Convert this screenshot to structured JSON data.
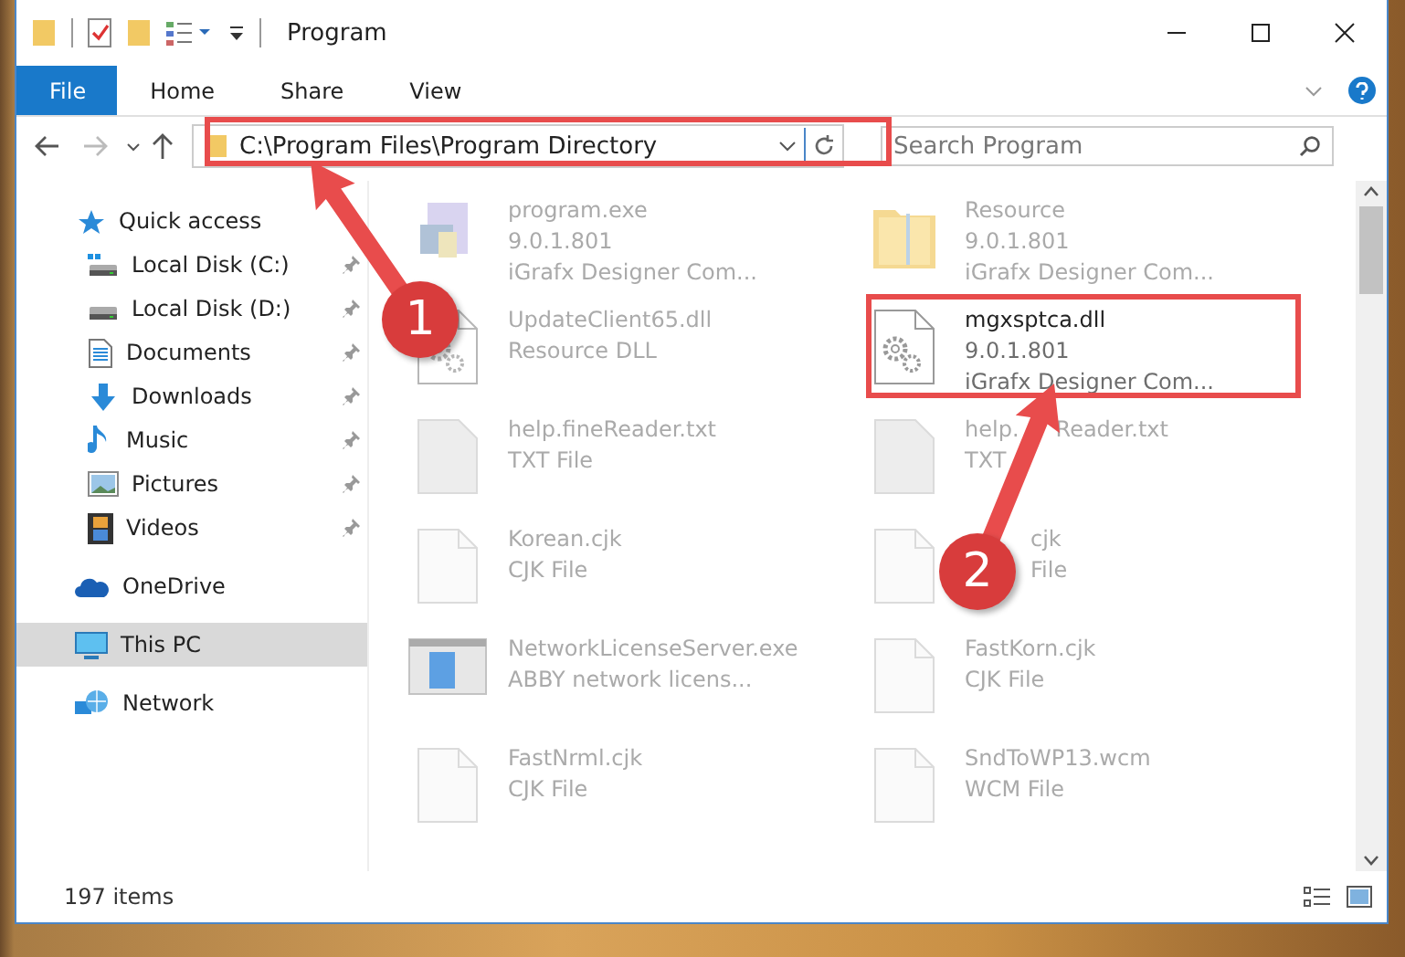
{
  "window": {
    "title": "Program"
  },
  "ribbon_tabs": [
    {
      "label": "File",
      "selected": true
    },
    {
      "label": "Home",
      "selected": false
    },
    {
      "label": "Share",
      "selected": false
    },
    {
      "label": "View",
      "selected": false
    }
  ],
  "address_bar": {
    "path": "C:\\Program Files\\Program Directory"
  },
  "search": {
    "placeholder": "Search Program"
  },
  "sidebar": {
    "items": [
      {
        "label": "Quick access",
        "kind": "star",
        "selected": false,
        "children": [
          {
            "label": "Local Disk (C:)",
            "kind": "drive-c",
            "pinned": true,
            "selected": false
          },
          {
            "label": "Local Disk (D:)",
            "kind": "drive",
            "pinned": true,
            "selected": false
          },
          {
            "label": "Documents",
            "kind": "document",
            "pinned": true,
            "selected": false
          },
          {
            "label": "Downloads",
            "kind": "download",
            "pinned": true,
            "selected": false
          },
          {
            "label": "Music",
            "kind": "music",
            "pinned": true,
            "selected": false
          },
          {
            "label": "Pictures",
            "kind": "pictures",
            "pinned": true,
            "selected": false
          },
          {
            "label": "Videos",
            "kind": "videos",
            "pinned": true,
            "selected": false
          }
        ]
      },
      {
        "label": "OneDrive",
        "kind": "cloud",
        "selected": false
      },
      {
        "label": "This PC",
        "kind": "pc",
        "selected": true
      },
      {
        "label": "Network",
        "kind": "network",
        "selected": false
      }
    ]
  },
  "files": [
    {
      "name": "program.exe",
      "details": [
        "9.0.1.801",
        "iGrafx Designer Com..."
      ],
      "kind": "app",
      "blurred": true
    },
    {
      "name": "Resource",
      "details": [
        "9.0.1.801",
        "iGrafx Designer Com..."
      ],
      "kind": "folder",
      "blurred": true
    },
    {
      "name": "UpdateClient65.dll",
      "details": [
        "Resource DLL"
      ],
      "kind": "dll",
      "blurred": true
    },
    {
      "name": "mgxsptca.dll",
      "details": [
        "9.0.1.801",
        "iGrafx Designer Com..."
      ],
      "kind": "dll",
      "blurred": false
    },
    {
      "name": "help.fineReader.txt",
      "details": [
        "TXT File"
      ],
      "kind": "text",
      "blurred": true
    },
    {
      "name": [
        "help.",
        "Reader.txt"
      ],
      "details": [
        "TXT"
      ],
      "kind": "text",
      "blurred": true
    },
    {
      "name": "Korean.cjk",
      "details": [
        "CJK File"
      ],
      "kind": "blank",
      "blurred": true
    },
    {
      "name": "cjk",
      "details": [
        "File"
      ],
      "kind": "blank",
      "blurred": true,
      "covered_start": true
    },
    {
      "name": "NetworkLicenseServer.exe",
      "details": [
        "ABBY network licens..."
      ],
      "kind": "window",
      "blurred": true
    },
    {
      "name": "FastKorn.cjk",
      "details": [
        "CJK File"
      ],
      "kind": "blank",
      "blurred": true
    },
    {
      "name": "FastNrml.cjk",
      "details": [
        "CJK File"
      ],
      "kind": "blank",
      "blurred": true
    },
    {
      "name": "SndToWP13.wcm",
      "details": [
        "WCM File"
      ],
      "kind": "blank",
      "blurred": true
    }
  ],
  "status_bar": {
    "item_count": "197 items"
  },
  "annotations": [
    {
      "label": "1"
    },
    {
      "label": "2"
    }
  ]
}
